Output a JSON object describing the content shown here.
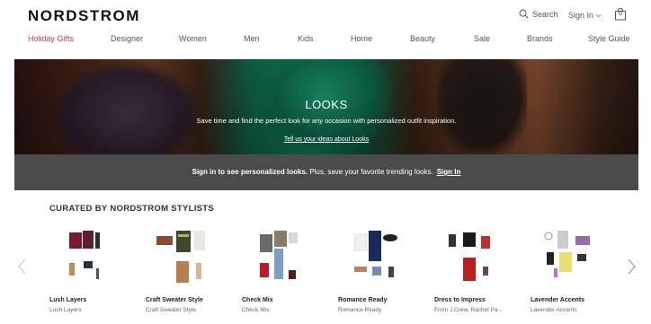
{
  "brand": "NORDSTROM",
  "header": {
    "search_label": "Search",
    "signin_label": "Sign In",
    "bag_count": "0"
  },
  "nav": [
    {
      "label": "Holiday Gifts",
      "active": true
    },
    {
      "label": "Designer"
    },
    {
      "label": "Women"
    },
    {
      "label": "Men"
    },
    {
      "label": "Kids"
    },
    {
      "label": "Home"
    },
    {
      "label": "Beauty"
    },
    {
      "label": "Sale"
    },
    {
      "label": "Brands"
    },
    {
      "label": "Style Guide"
    }
  ],
  "hero": {
    "title": "LOOKS",
    "subtitle": "Save time and find the perfect look for any occasion with personalized outfit inspiration.",
    "link": "Tell us your ideas about Looks"
  },
  "signbar": {
    "bold_text": "Sign in to see personalized looks.",
    "text": " Plus, save your favorite trending looks.",
    "link": "Sign In"
  },
  "curated": {
    "title": "CURATED BY NORDSTROM STYLISTS",
    "looks": [
      {
        "name": "Lush Layers",
        "by": "Lush Layers"
      },
      {
        "name": "Craft Sweater Style",
        "by": "Craft Sweater Style"
      },
      {
        "name": "Check Mix",
        "by": "Check Mix"
      },
      {
        "name": "Romance Ready",
        "by": "Romance Ready"
      },
      {
        "name": "Dress to Impress",
        "by": "From J.Crew, Rachel Pa..."
      },
      {
        "name": "Lavender Accents",
        "by": "Lavender Accents"
      }
    ]
  },
  "colors": {
    "accent": "#e03a3e",
    "signbar": "#4b4b4b"
  }
}
